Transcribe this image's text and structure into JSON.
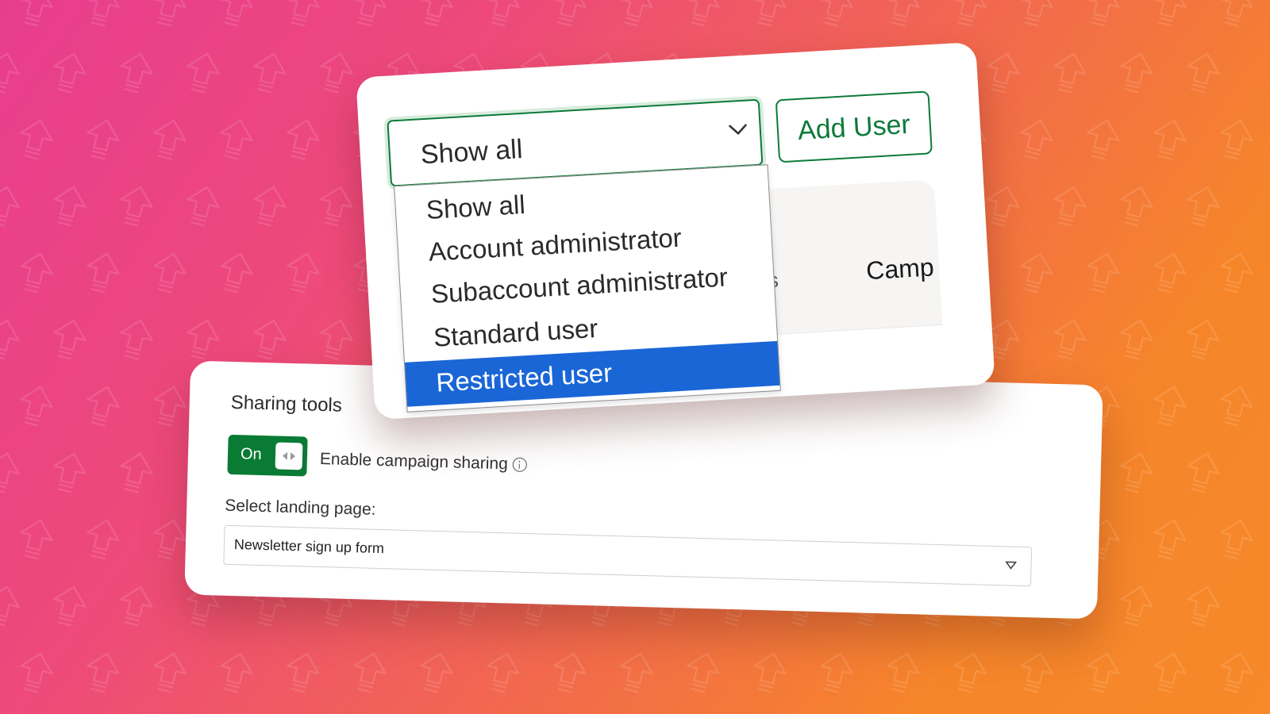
{
  "user_filter": {
    "selected_value": "Show all",
    "options": [
      "Show all",
      "Account administrator",
      "Subaccount administrator",
      "Standard user",
      "Restricted user"
    ],
    "highlighted_option": "Restricted user"
  },
  "add_user_button": {
    "label": "Add User"
  },
  "users_table": {
    "visible_column_header": "Camp"
  },
  "sharing_tools": {
    "title": "Sharing tools",
    "toggle": {
      "label": "On",
      "state": "on"
    },
    "toggle_description": "Enable campaign sharing",
    "landing_page_label": "Select landing page:",
    "landing_page_value": "Newsletter sign up form"
  },
  "colors": {
    "accent_green": "#0a7b34",
    "selected_option_blue": "#1a66d6",
    "background_gradient_start": "#e83d8f",
    "background_gradient_end": "#f7892a"
  },
  "icons": [
    "chevron-down-icon",
    "info-icon",
    "caret-down-icon",
    "toggle-grip-icon",
    "upload-arrow-icon"
  ]
}
